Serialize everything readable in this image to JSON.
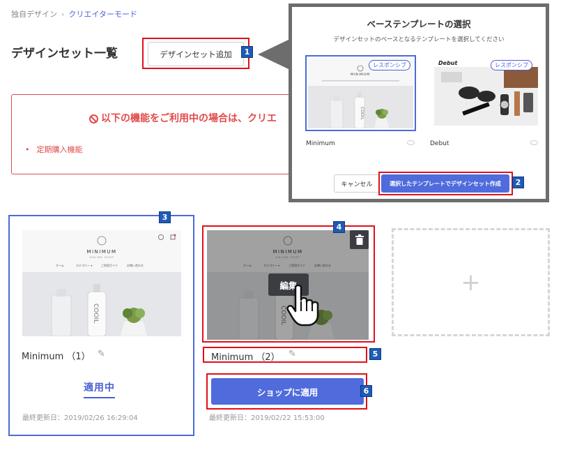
{
  "breadcrumb": {
    "parent": "独自デザイン",
    "current": "クリエイターモード"
  },
  "page_title": "デザインセット一覧",
  "add_button_label": "デザインセット追加",
  "alert": {
    "title": "以下の機能をご利用中の場合は、クリエ",
    "items": [
      "定期購入機能"
    ]
  },
  "modal": {
    "title": "ベーステンプレートの選択",
    "subtitle": "デザインセットのベースとなるテンプレートを選択してください",
    "templates": [
      {
        "name": "Minimum",
        "tag": "レスポンシブ"
      },
      {
        "name": "Debut",
        "tag": "レスポンシブ"
      }
    ],
    "cancel_label": "キャンセル",
    "confirm_label": "選択したテンプレートでデザインセット作成"
  },
  "thumbnail": {
    "brand": "MINIMUM",
    "brand_sub": "ONLINE SHOP",
    "nav": [
      "ホーム",
      "カテゴリー ▾",
      "ご利用ガイド",
      "お問い合わせ"
    ],
    "bottle_text": "COOIL",
    "debut_logo": "Debut"
  },
  "cards": [
    {
      "name": "Minimum （1）",
      "status": "適用中",
      "updated": "最終更新日：2019/02/26 16:29:04"
    },
    {
      "name": "Minimum （2）",
      "edit_overlay": "編集",
      "apply_label": "ショップに適用",
      "updated": "最終更新日：2019/02/22 15:53:00"
    }
  ],
  "add_card_symbol": "+",
  "callouts": [
    "1",
    "2",
    "3",
    "4",
    "5",
    "6"
  ],
  "colors": {
    "accent": "#4f6bdc",
    "alert": "#e24a4a",
    "callout_border": "#e0101a",
    "callout_badge": "#1e5bb5"
  }
}
